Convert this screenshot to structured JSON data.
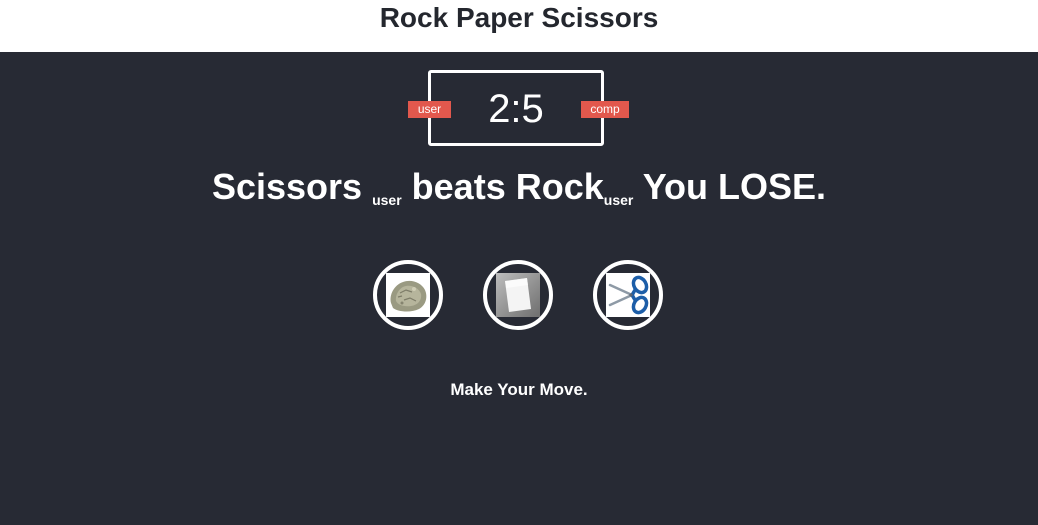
{
  "header": {
    "title": "Rock Paper Scissors"
  },
  "scoreboard": {
    "score": "2:5",
    "user_label": "user",
    "comp_label": "comp"
  },
  "result": {
    "left_choice": "Scissors",
    "left_sub": "user",
    "verb": "beats",
    "right_choice": "Rock",
    "right_sub": "user",
    "outcome": "You LOSE."
  },
  "choices": [
    {
      "name": "rock",
      "icon": "rock-icon"
    },
    {
      "name": "paper",
      "icon": "paper-icon"
    },
    {
      "name": "scissors",
      "icon": "scissors-icon"
    }
  ],
  "message": "Make Your Move.",
  "colors": {
    "header_bg": "#ffffff",
    "main_bg": "#272a34",
    "badge": "#e2584d",
    "text": "#ffffff",
    "title_text": "#24272e"
  }
}
